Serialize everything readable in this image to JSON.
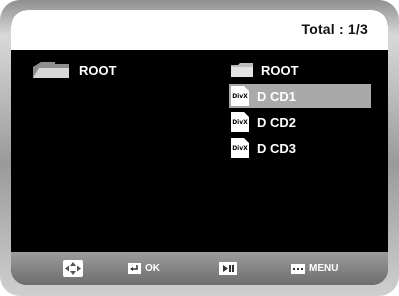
{
  "header": {
    "total": "Total : 1/3"
  },
  "left_pane": {
    "folder_label": "ROOT"
  },
  "right_pane": {
    "items": [
      {
        "label": "ROOT",
        "type": "folder",
        "selected": false
      },
      {
        "label": "D CD1",
        "type": "divx",
        "selected": true
      },
      {
        "label": "D CD2",
        "type": "divx",
        "selected": false
      },
      {
        "label": "D CD3",
        "type": "divx",
        "selected": false
      }
    ],
    "file_icon_text": "DivX"
  },
  "footer": {
    "ok_label": "OK",
    "menu_label": "MENU"
  },
  "colors": {
    "selection": "#a9a9a9",
    "background": "#000000",
    "header": "#ffffff"
  }
}
